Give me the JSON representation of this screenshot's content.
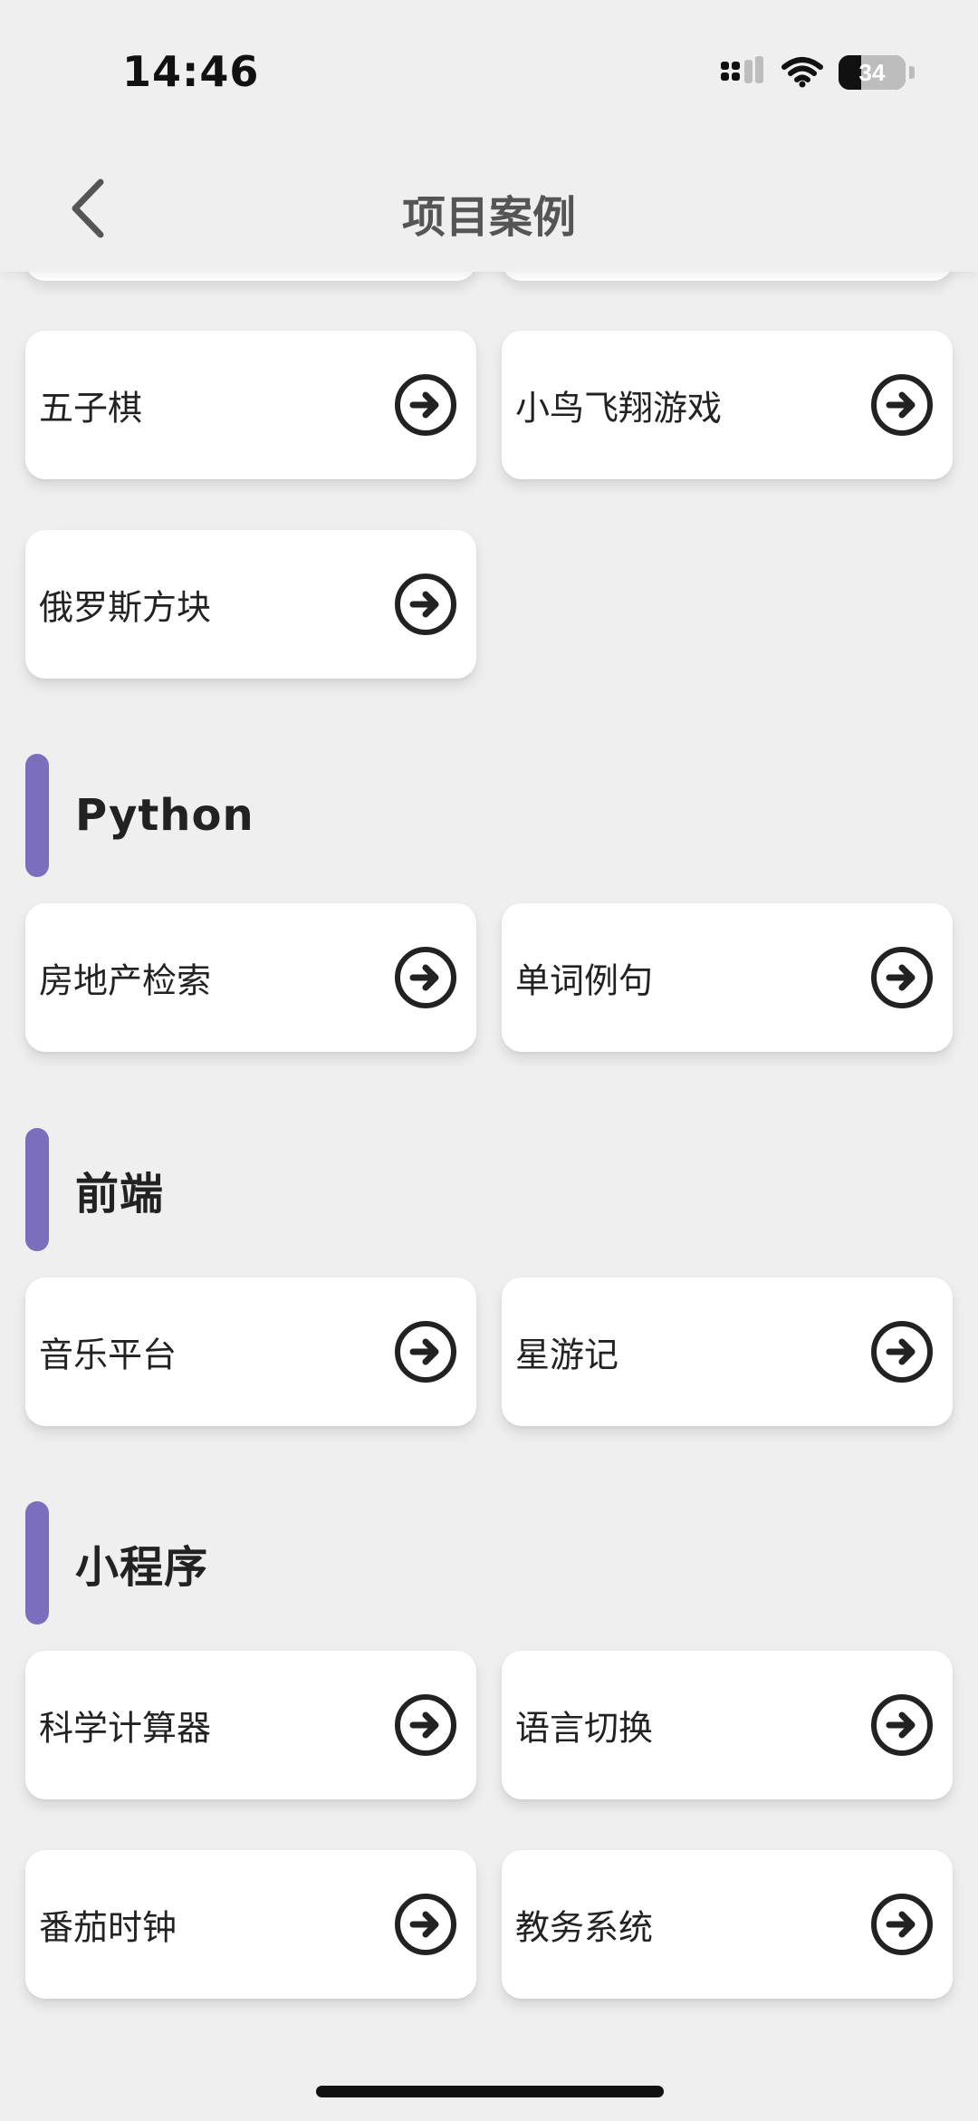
{
  "status_bar": {
    "time": "14:46",
    "battery_level": "34",
    "battery_fraction": 0.34
  },
  "nav": {
    "title": "项目案例",
    "back_icon": "chevron-left-icon"
  },
  "colors": {
    "section_accent": "#7b6fbd",
    "background": "#efeff0",
    "card": "#ffffff"
  },
  "groups": [
    {
      "title": "",
      "items": [
        {
          "label": "五子棋"
        },
        {
          "label": "小鸟飞翔游戏"
        },
        {
          "label": "俄罗斯方块"
        }
      ]
    },
    {
      "title": "Python",
      "items": [
        {
          "label": "房地产检索"
        },
        {
          "label": "单词例句"
        }
      ]
    },
    {
      "title": "前端",
      "items": [
        {
          "label": "音乐平台"
        },
        {
          "label": "星游记"
        }
      ]
    },
    {
      "title": "小程序",
      "items": [
        {
          "label": "科学计算器"
        },
        {
          "label": "语言切换"
        },
        {
          "label": "番茄时钟"
        },
        {
          "label": "教务系统"
        }
      ]
    }
  ],
  "item_icon": "arrow-right-circle-icon"
}
